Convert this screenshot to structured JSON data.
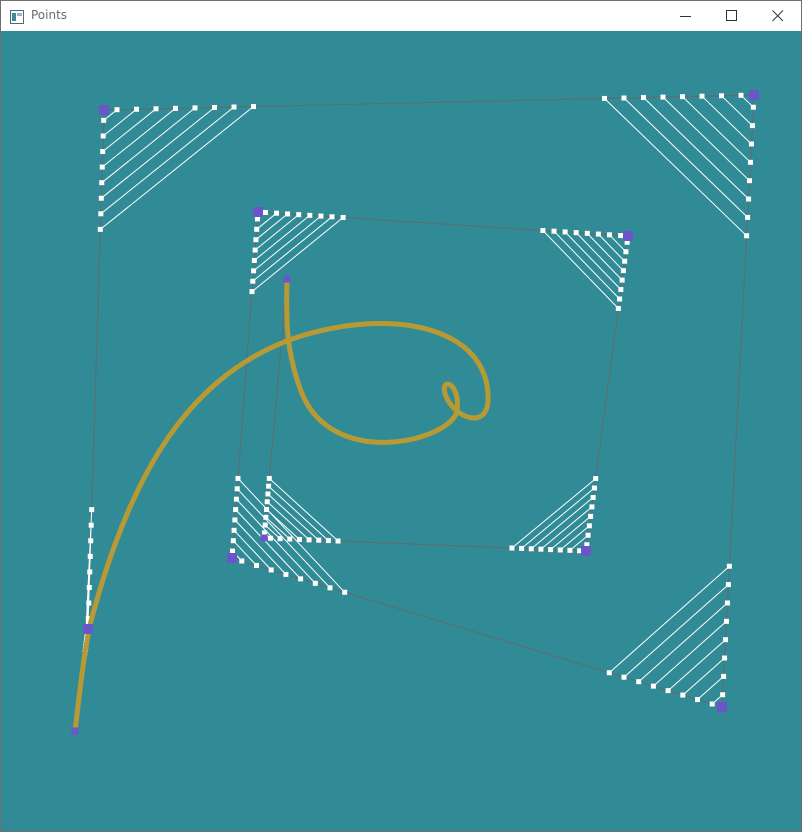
{
  "window": {
    "title": "Points",
    "app_icon": "window-app-icon",
    "controls": {
      "minimize_icon": "minimize-icon",
      "maximize_icon": "maximize-icon",
      "close_icon": "close-icon"
    }
  },
  "canvas": {
    "background_color": "#318b96",
    "control_point_color": "#6a56c8",
    "construction_line_color": "#ffffff",
    "polygon_color": "#5b6e74",
    "curve_color": "#b89a35",
    "control_point_count": 11,
    "description_visible": false
  }
}
